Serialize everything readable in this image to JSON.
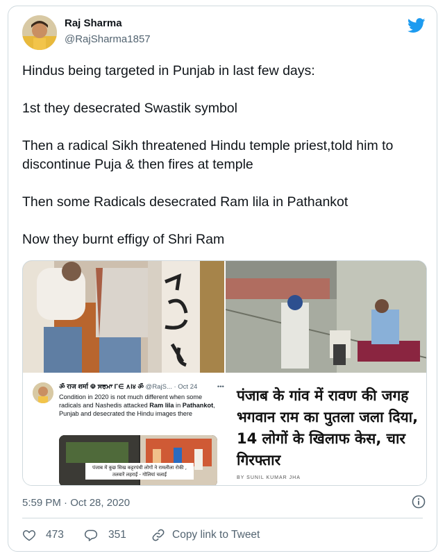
{
  "author": {
    "name": "Raj Sharma",
    "handle": "@RajSharma1857"
  },
  "tweet": {
    "lines": [
      "Hindus being targeted in Punjab in last few days:",
      "1st they desecrated Swastik symbol",
      "Then a radical Sikh threatened Hindu temple priest,told him to discontinue Puja & then fires at temple",
      "Then some Radicals desecrated Ram lila in Pathankot",
      "Now they burnt effigy of Shri Ram"
    ],
    "timestamp": "5:59 PM · Oct 28, 2020"
  },
  "media": {
    "news_headline": "पंजाब के गांव में रावण की जगह भगवान राम का पुतला जला दिया, 14 लोगों के खिलाफ केस, चार गिरफ्तार",
    "news_byline": "BY SUNIL KUMAR JHA",
    "quoted": {
      "name": "ॐ राज शर्मा ☫ ਸਰਮਾ Γ∈ ∧I४ ॐ",
      "handle": "@RajS...",
      "date": "· Oct 24",
      "more": "•••",
      "body_1": "Condition in 2020 is not much different when some radicals and Nashedis attacked ",
      "body_bold_1": "Ram lila",
      "body_2": " in ",
      "body_bold_2": "Pathankot",
      "body_3": ", Punjab and desecrated the Hindu images there",
      "caption": "पंजाब में कुछ सिख कट्टरपंथी लोगों ने रामलीला रोकी , तलवारें लहराईं - गोलियां चलाईं"
    }
  },
  "actions": {
    "likes": "473",
    "replies": "351",
    "copy_link": "Copy link to Tweet"
  },
  "colors": {
    "brand_blue": "#1d9bf0",
    "muted": "#536471",
    "border": "#cfd9de"
  }
}
